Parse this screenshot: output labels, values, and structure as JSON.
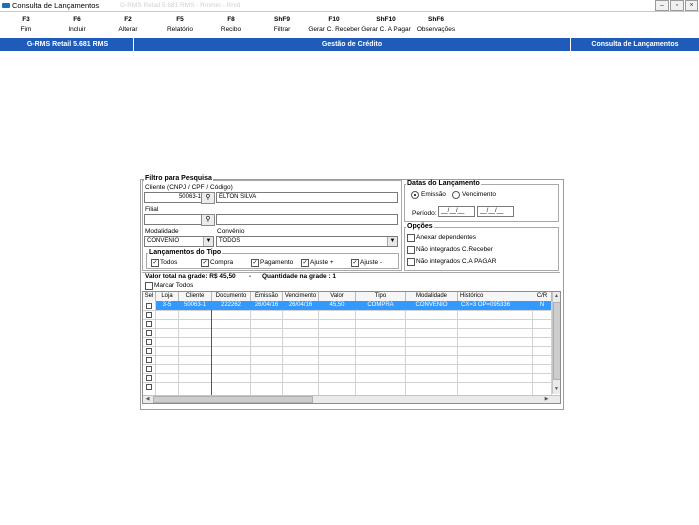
{
  "window": {
    "title": "Consulta de Lançamentos",
    "faint_text": "G-RMS Retail 5.681 RMS - Rmmio  -  Rrvd"
  },
  "toolbar": [
    {
      "key": "F3",
      "label": "Fim"
    },
    {
      "key": "F6",
      "label": "Incluir"
    },
    {
      "key": "F2",
      "label": "Alterar"
    },
    {
      "key": "F5",
      "label": "Relatório"
    },
    {
      "key": "F8",
      "label": "Recibo"
    },
    {
      "key": "ShF9",
      "label": "Filtrar"
    },
    {
      "key": "F10",
      "label": "Gerar C. Receber"
    },
    {
      "key": "ShF10",
      "label": "Gerar C. A Pagar"
    },
    {
      "key": "ShF6",
      "label": "Observações"
    }
  ],
  "band": {
    "app": "G-RMS Retail 5.681 RMS",
    "module": "Gestão de Crédito",
    "screen": "Consulta de Lançamentos",
    "color": "#1f5bb8"
  },
  "filter": {
    "title": "Filtro para Pesquisa",
    "cliente_label": "Cliente (CNPJ / CPF / Código)",
    "cliente_code": "50063-1",
    "cliente_name": "ELTON SILVA",
    "filial_label": "Filial",
    "filial_code": "",
    "filial_name": "",
    "modalidade_label": "Modalidade",
    "modalidade_value": "CONVENIO",
    "convenio_label": "Convênio",
    "convenio_value": "TODOS",
    "tipo_title": "Lançamentos do Tipo",
    "tipos": [
      {
        "label": "Todos",
        "checked": true
      },
      {
        "label": "Compra",
        "checked": true
      },
      {
        "label": "Pagamento",
        "checked": true
      },
      {
        "label": "Ajuste +",
        "checked": true
      },
      {
        "label": "Ajuste -",
        "checked": true
      }
    ]
  },
  "datas": {
    "title": "Datas do Lançamento",
    "emissao": "Emissão",
    "vencimento": "Vencimento",
    "selected": "Emissão",
    "periodo_label": "Período:",
    "date_from": "__/__/__",
    "date_to": "__/__/__"
  },
  "opcoes": {
    "title": "Opções",
    "items": [
      {
        "label": "Anexar dependentes",
        "checked": false
      },
      {
        "label": "Não integrados C.Receber",
        "checked": false
      },
      {
        "label": "Não integrados C.A PAGAR",
        "checked": false
      }
    ]
  },
  "summary": {
    "total_label": "Valor total na grade: R$ 45,50",
    "dash": "-",
    "qty_label": "Quantidade na grade : 1",
    "marcar_todos": "Marcar Todos"
  },
  "grid": {
    "columns": [
      "Sel",
      "Loja",
      "Cliente",
      "Documento",
      "Emissão",
      "Vencimento",
      "Valor",
      "Tipo",
      "Modalidade",
      "Histórico",
      "C/R"
    ],
    "rows": [
      {
        "sel": "",
        "loja": "3-5",
        "cliente": "50063-1",
        "documento": "222262",
        "emissao": "26/04/16",
        "vencimento": "26/04/16",
        "valor": "45,50",
        "tipo": "COMPRA",
        "modalidade": "CONVENIO",
        "historico": "CX=3 OP=095336",
        "cr": "N"
      }
    ],
    "selected_color": "#3399ff"
  }
}
